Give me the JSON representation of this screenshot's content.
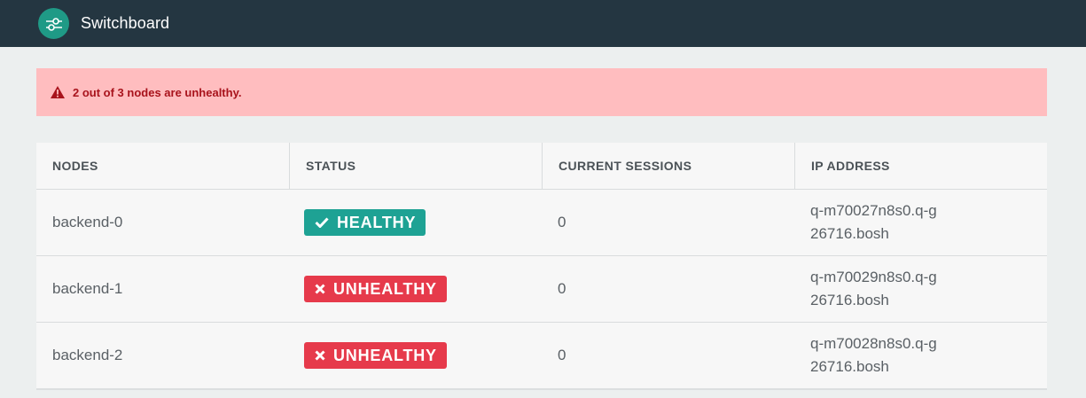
{
  "app": {
    "title": "Switchboard"
  },
  "alert": {
    "message": "2 out of 3 nodes are unhealthy.",
    "icon": "warning-icon",
    "color": "#a8131c"
  },
  "table": {
    "headers": [
      "NODES",
      "STATUS",
      "CURRENT SESSIONS",
      "IP ADDRESS"
    ],
    "rows": [
      {
        "node": "backend-0",
        "status": "HEALTHY",
        "status_icon": "check-icon",
        "sessions": "0",
        "ip": "q-m70027n8s0.q-g26716.bosh"
      },
      {
        "node": "backend-1",
        "status": "UNHEALTHY",
        "status_icon": "x-icon",
        "sessions": "0",
        "ip": "q-m70029n8s0.q-g26716.bosh"
      },
      {
        "node": "backend-2",
        "status": "UNHEALTHY",
        "status_icon": "x-icon",
        "sessions": "0",
        "ip": "q-m70028n8s0.q-g26716.bosh"
      }
    ]
  },
  "colors": {
    "topbar": "#243641",
    "brand": "#1f9a86",
    "healthy": "#1ea294",
    "unhealthy": "#e63a4b",
    "alert_bg": "#ffbdbf"
  }
}
